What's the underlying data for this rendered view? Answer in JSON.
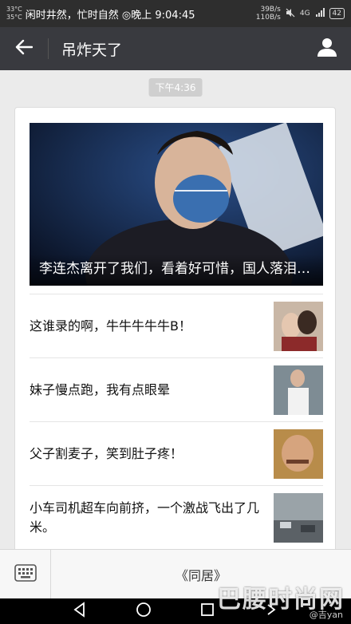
{
  "status_bar": {
    "temp_high": "33°C",
    "temp_low": "35°C",
    "text": "闲时井然，忙时自然 ◎晚上 9:04:45",
    "net_up": "39B/s",
    "net_down": "110B/s",
    "signal": "4G",
    "battery": "42"
  },
  "header": {
    "title": "吊炸天了"
  },
  "timestamp": "下午4:36",
  "hero_article": {
    "title": "李连杰离开了我们，看着好可惜，国人落泪…"
  },
  "articles": [
    {
      "title": "这谁录的啊，牛牛牛牛牛B！"
    },
    {
      "title": "妹子慢点跑，我有点眼晕"
    },
    {
      "title": "父子割麦子，笑到肚子疼！"
    },
    {
      "title": "小车司机超车向前挤，一个激战飞出了几米。"
    }
  ],
  "bottom_menu": {
    "item": "《同居》"
  },
  "watermark": {
    "text": "巴腰时尚网",
    "weibo": "@吉yan"
  },
  "colors": {
    "titlebar": "#393a3f",
    "statusbar": "#2e2e2e",
    "background": "#ebebeb"
  }
}
